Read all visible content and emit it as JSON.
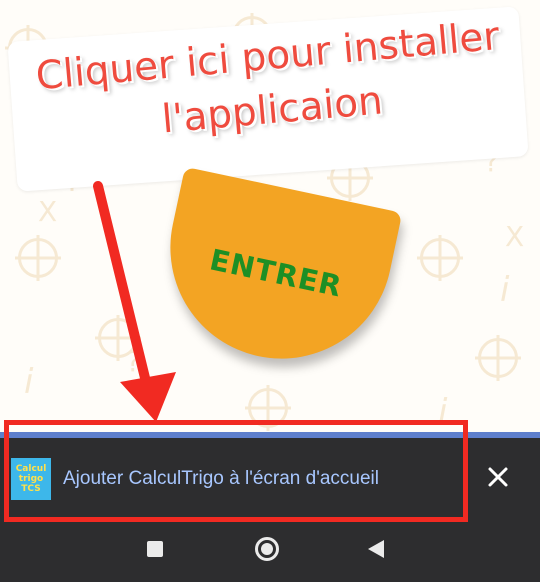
{
  "overlay": {
    "headline_line1": "Cliquer ici pour installer",
    "headline_line2": "l'applicaion"
  },
  "enter_button": {
    "label": "ENTRER"
  },
  "install_banner": {
    "app_icon_lines": [
      "Calcul",
      "trigo",
      "TCS"
    ],
    "label": "Ajouter CalculTrigo à l'écran d'accueil",
    "close_icon": "close-icon"
  },
  "nav_bar": {
    "icons": [
      "recent-apps-icon",
      "home-icon",
      "back-icon"
    ]
  },
  "colors": {
    "headline": "#ef4b3e",
    "enter_button_fill": "#f3a423",
    "enter_label": "#1d8f25",
    "banner_link": "#a8c7ff",
    "highlight_red": "#f12a22",
    "banner_accent": "#5e7fcd",
    "app_icon_bg": "#3db7ea",
    "app_icon_text": "#ffe14a"
  }
}
